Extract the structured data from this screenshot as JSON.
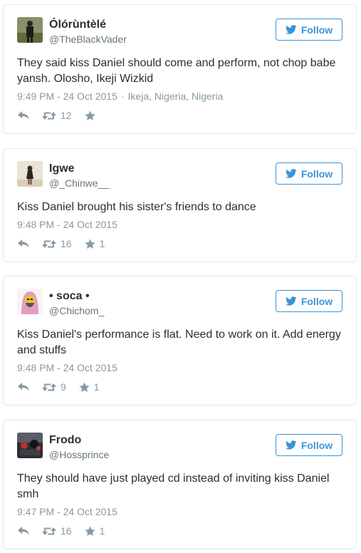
{
  "follow_label": "Follow",
  "colors": {
    "twitter_blue": "#3b94d9",
    "meta_gray": "#8899a6",
    "border": "#e1e8ed"
  },
  "icons": {
    "follow": "twitter-bird-icon",
    "reply": "reply-icon",
    "retweet": "retweet-icon",
    "like": "star-icon"
  },
  "tweets": [
    {
      "name": "Ólórùntèlé",
      "handle": "@TheBlackVader",
      "text": "They said kiss Daniel should come and perform, not chop babe yansh. Olosho, Ikeji Wizkid",
      "time": "9:49 PM - 24 Oct 2015",
      "location": "Ikeja, Nigeria, Nigeria",
      "retweets": "12",
      "likes": ""
    },
    {
      "name": "Igwe",
      "handle": "@_Chinwe__",
      "text": "Kiss Daniel brought his sister's friends to dance",
      "time": "9:48 PM - 24 Oct 2015",
      "retweets": "16",
      "likes": "1"
    },
    {
      "name": "• soca •",
      "handle": "@Chichom_",
      "text": "Kiss Daniel's performance is flat. Need to work on it. Add energy and stuffs",
      "time": "9:48 PM - 24 Oct 2015",
      "retweets": "9",
      "likes": "1"
    },
    {
      "name": "Frodo",
      "handle": "@Hossprince",
      "text": "They should have just played cd instead of inviting kiss Daniel smh",
      "time": "9:47 PM - 24 Oct 2015",
      "retweets": "16",
      "likes": "1"
    }
  ]
}
